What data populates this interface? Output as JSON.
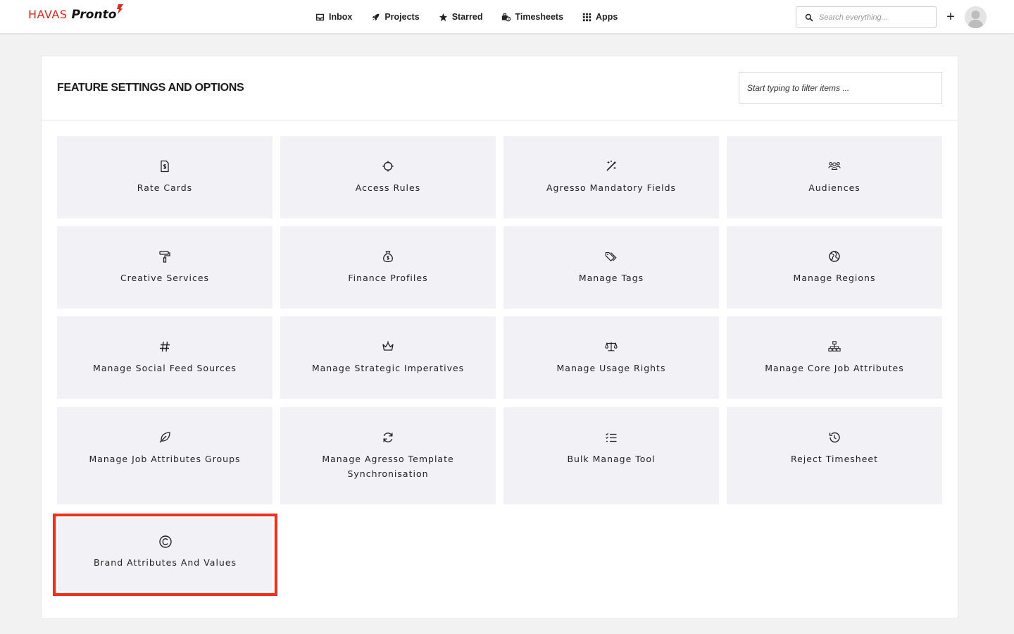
{
  "header": {
    "logo_havas": "HAVAS",
    "logo_pronto": "Pronto",
    "nav": [
      {
        "label": "Inbox",
        "icon": "inbox-icon"
      },
      {
        "label": "Projects",
        "icon": "rocket-icon"
      },
      {
        "label": "Starred",
        "icon": "star-icon"
      },
      {
        "label": "Timesheets",
        "icon": "timesheet-icon"
      },
      {
        "label": "Apps",
        "icon": "apps-grid-icon"
      }
    ],
    "search_placeholder": "Search everything...",
    "plus_label": "+"
  },
  "panel": {
    "title": "FEATURE SETTINGS AND OPTIONS",
    "filter_placeholder": "Start typing to filter items ..."
  },
  "tiles": [
    {
      "label": "Rate Cards",
      "icon": "rate-card-icon"
    },
    {
      "label": "Access Rules",
      "icon": "access-rules-icon"
    },
    {
      "label": "Agresso Mandatory Fields",
      "icon": "magic-wand-icon"
    },
    {
      "label": "Audiences",
      "icon": "people-group-icon"
    },
    {
      "label": "Creative Services",
      "icon": "paint-roller-icon"
    },
    {
      "label": "Finance Profiles",
      "icon": "money-bag-icon"
    },
    {
      "label": "Manage Tags",
      "icon": "tags-icon"
    },
    {
      "label": "Manage Regions",
      "icon": "globe-icon"
    },
    {
      "label": "Manage Social Feed Sources",
      "icon": "hashtag-icon"
    },
    {
      "label": "Manage Strategic Imperatives",
      "icon": "crown-icon"
    },
    {
      "label": "Manage Usage Rights",
      "icon": "scales-icon"
    },
    {
      "label": "Manage Core Job Attributes",
      "icon": "sitemap-icon"
    },
    {
      "label": "Manage Job Attributes Groups",
      "icon": "feather-icon"
    },
    {
      "label": "Manage Agresso Template Synchronisation",
      "icon": "sync-icon"
    },
    {
      "label": "Bulk Manage Tool",
      "icon": "list-check-icon"
    },
    {
      "label": "Reject Timesheet",
      "icon": "history-icon"
    }
  ],
  "brand_tile": {
    "label": "Brand Attributes And Values",
    "icon": "copyright-icon"
  },
  "colors": {
    "brand_red": "#e1261c",
    "highlight": "#f0301a",
    "tile_bg": "#f1f1f6"
  }
}
